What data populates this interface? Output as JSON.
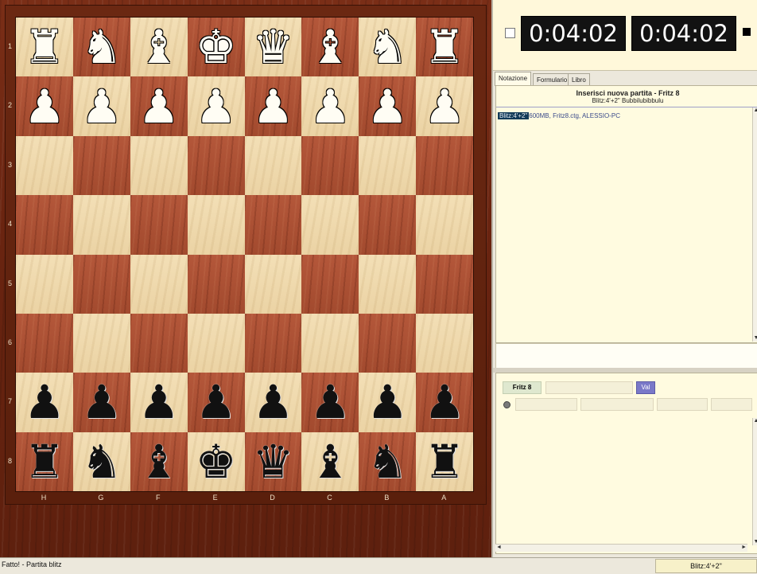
{
  "board": {
    "ranks": [
      "1",
      "2",
      "3",
      "4",
      "5",
      "6",
      "7",
      "8"
    ],
    "files": [
      "H",
      "G",
      "F",
      "E",
      "D",
      "C",
      "B",
      "A"
    ],
    "rows": [
      [
        {
          "p": "♜",
          "c": "white",
          "n": "rook"
        },
        {
          "p": "♞",
          "c": "white",
          "n": "knight"
        },
        {
          "p": "♝",
          "c": "white",
          "n": "bishop"
        },
        {
          "p": "♚",
          "c": "white",
          "n": "king"
        },
        {
          "p": "♛",
          "c": "white",
          "n": "queen"
        },
        {
          "p": "♝",
          "c": "white",
          "n": "bishop"
        },
        {
          "p": "♞",
          "c": "white",
          "n": "knight"
        },
        {
          "p": "♜",
          "c": "white",
          "n": "rook"
        }
      ],
      [
        {
          "p": "♟",
          "c": "white",
          "n": "pawn"
        },
        {
          "p": "♟",
          "c": "white",
          "n": "pawn"
        },
        {
          "p": "♟",
          "c": "white",
          "n": "pawn"
        },
        {
          "p": "♟",
          "c": "white",
          "n": "pawn"
        },
        {
          "p": "♟",
          "c": "white",
          "n": "pawn"
        },
        {
          "p": "♟",
          "c": "white",
          "n": "pawn"
        },
        {
          "p": "♟",
          "c": "white",
          "n": "pawn"
        },
        {
          "p": "♟",
          "c": "white",
          "n": "pawn"
        }
      ],
      [
        null,
        null,
        null,
        null,
        null,
        null,
        null,
        null
      ],
      [
        null,
        null,
        null,
        null,
        null,
        null,
        null,
        null
      ],
      [
        null,
        null,
        null,
        null,
        null,
        null,
        null,
        null
      ],
      [
        null,
        null,
        null,
        null,
        null,
        null,
        null,
        null
      ],
      [
        {
          "p": "♟",
          "c": "black",
          "n": "pawn"
        },
        {
          "p": "♟",
          "c": "black",
          "n": "pawn"
        },
        {
          "p": "♟",
          "c": "black",
          "n": "pawn"
        },
        {
          "p": "♟",
          "c": "black",
          "n": "pawn"
        },
        {
          "p": "♟",
          "c": "black",
          "n": "pawn"
        },
        {
          "p": "♟",
          "c": "black",
          "n": "pawn"
        },
        {
          "p": "♟",
          "c": "black",
          "n": "pawn"
        },
        {
          "p": "♟",
          "c": "black",
          "n": "pawn"
        }
      ],
      [
        {
          "p": "♜",
          "c": "black",
          "n": "rook"
        },
        {
          "p": "♞",
          "c": "black",
          "n": "knight"
        },
        {
          "p": "♝",
          "c": "black",
          "n": "bishop"
        },
        {
          "p": "♚",
          "c": "black",
          "n": "king"
        },
        {
          "p": "♛",
          "c": "black",
          "n": "queen"
        },
        {
          "p": "♝",
          "c": "black",
          "n": "bishop"
        },
        {
          "p": "♞",
          "c": "black",
          "n": "knight"
        },
        {
          "p": "♜",
          "c": "black",
          "n": "rook"
        }
      ]
    ]
  },
  "clocks": {
    "left": "0:04:02",
    "right": "0:04:02"
  },
  "tabs": [
    {
      "label": "Notazione",
      "active": true
    },
    {
      "label": "Formulario",
      "active": false
    },
    {
      "label": "Libro",
      "active": false
    }
  ],
  "notation": {
    "title": "Inserisci nuova partita - Fritz 8",
    "subtitle": "Blitz:4'+2\" Bubbilubibbulu",
    "tag": "Blitz:4'+2\"",
    "text": "600MB, Fritz8.ctg, ALESSIO-PC",
    "scroll_up": "▲",
    "scroll_down": "▼"
  },
  "engine": {
    "name": "Fritz 8",
    "button_label": "Val",
    "scroll_left": "◄",
    "scroll_right": "►",
    "scroll_up": "▲",
    "scroll_down": "▼"
  },
  "status": {
    "left": "Fatto! - Partita blitz",
    "right": "Blitz:4'+2\""
  },
  "colors": {
    "light_square": "#f3dfb6",
    "dark_square": "#b4573a",
    "frame": "#6a2410",
    "panel": "#fffbe0"
  }
}
